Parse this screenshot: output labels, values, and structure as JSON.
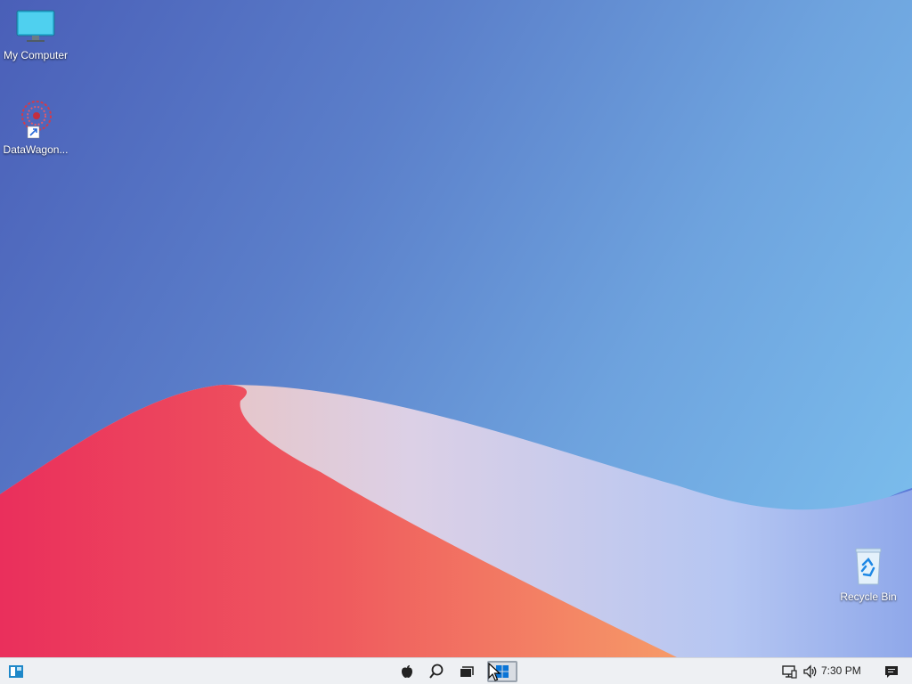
{
  "desktop": {
    "icons": [
      {
        "label": "My Computer",
        "icon": "monitor-icon"
      },
      {
        "label": "DataWagon...",
        "icon": "datawagon-shortcut-icon"
      },
      {
        "label": "Recycle Bin",
        "icon": "recycle-bin-icon"
      }
    ]
  },
  "taskbar": {
    "left_button": {
      "icon": "widgets-panel-icon"
    },
    "center_buttons": [
      {
        "icon": "apple-icon"
      },
      {
        "icon": "search-icon"
      },
      {
        "icon": "task-view-icon"
      },
      {
        "icon": "start-windows-icon",
        "active": true
      }
    ],
    "tray": {
      "network_icon": "network-icon",
      "volume_icon": "volume-icon",
      "clock": "7:30 PM",
      "notifications_icon": "action-center-icon"
    }
  },
  "colors": {
    "taskbar_bg": "#eef0f3",
    "sand_red": "#ec4560",
    "sky_blue": "#7dc2ef"
  }
}
